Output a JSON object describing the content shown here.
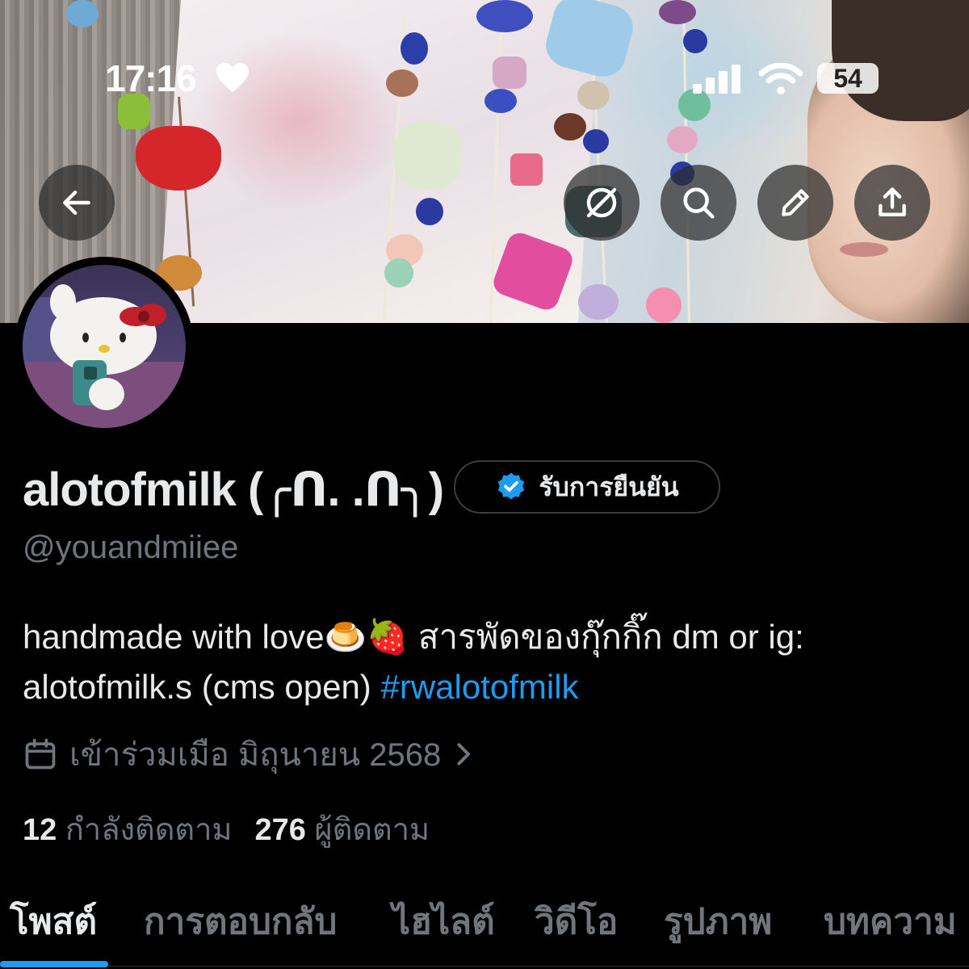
{
  "status_bar": {
    "time": "17:16",
    "battery": "54"
  },
  "nav": {
    "back": "back-arrow-icon",
    "grok": "grok-icon",
    "search": "search-icon",
    "edit": "pencil-icon",
    "share": "share-icon"
  },
  "profile": {
    "display_name": "alotofmilk (╭ᑎ.  .ᑎ╮)",
    "verify_label": "รับการยืนยัน",
    "handle": "@youandmiiee",
    "bio_line1": "handmade with love🍮🍓  สารพัดของกุ๊กกิ๊ก dm or ig:",
    "bio_line2_text": "alotofmilk.s (cms open) ",
    "bio_hashtag": "#rwalotofmilk",
    "joined": "เข้าร่วมเมือ มิถุนายน 2568",
    "following_count": "12",
    "following_label": "กำลังติดตาม",
    "followers_count": "276",
    "followers_label": "ผู้ติดตาม"
  },
  "tabs": [
    {
      "label": "โพสต์",
      "active": true
    },
    {
      "label": "การตอบกลับ",
      "active": false
    },
    {
      "label": "ไฮไลต์",
      "active": false
    },
    {
      "label": "วิดีโอ",
      "active": false
    },
    {
      "label": "รูปภาพ",
      "active": false
    },
    {
      "label": "บทความ",
      "active": false
    }
  ],
  "colors": {
    "background": "#000000",
    "accent": "#1d9bf0",
    "text": "#e7e9ea",
    "muted": "#71767b"
  }
}
